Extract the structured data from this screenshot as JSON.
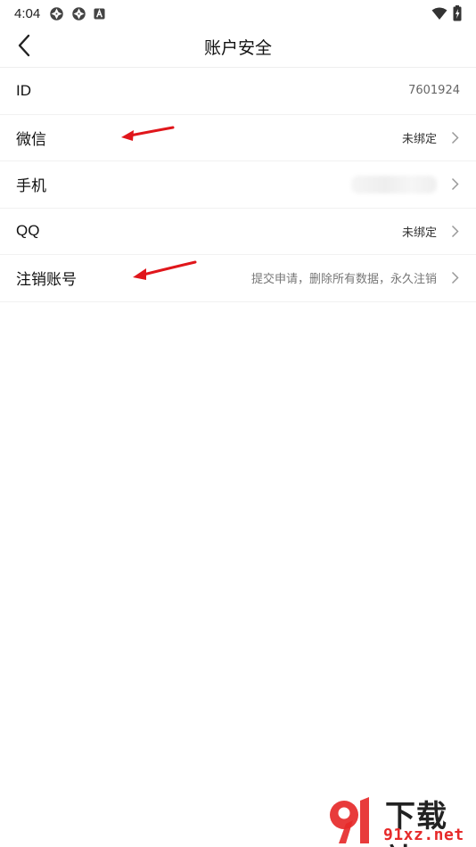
{
  "status_bar": {
    "time": "4:04",
    "left_icons": [
      "aperture-icon",
      "aperture-icon",
      "a-badge-icon"
    ],
    "right_icons": [
      "wifi-icon",
      "battery-icon"
    ]
  },
  "header": {
    "title": "账户安全",
    "back_icon": "chevron-left-icon"
  },
  "rows": [
    {
      "label": "ID",
      "value": "7601924"
    },
    {
      "label": "微信",
      "value": "未绑定"
    },
    {
      "label": "手机",
      "value": ""
    },
    {
      "label": "QQ",
      "value": "未绑定"
    },
    {
      "label": "注销账号",
      "value": "提交申请，删除所有数据，永久注销"
    }
  ],
  "annotations": {
    "arrow_color": "#e0161b"
  },
  "watermark": {
    "brand_text": "下载站",
    "domain_text": "91xz.net",
    "colors": {
      "red": "#e62a2a",
      "dark": "#222222"
    }
  }
}
